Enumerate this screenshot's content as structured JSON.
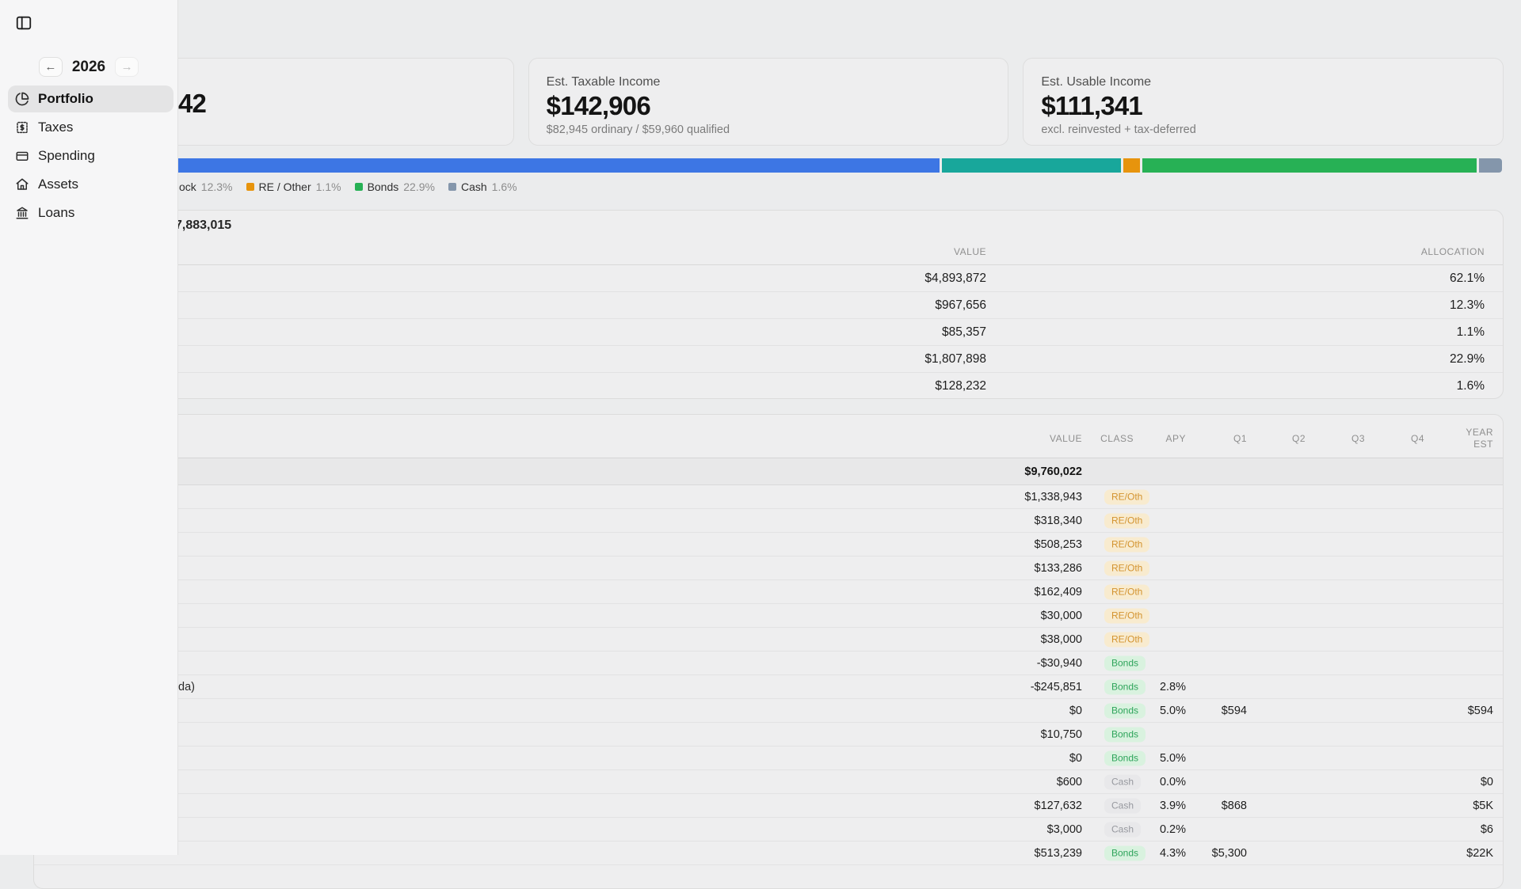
{
  "sidebar": {
    "year": "2026",
    "prev_label": "←",
    "next_label": "→",
    "items": [
      {
        "label": "Portfolio",
        "icon": "pie-chart-icon",
        "active": true
      },
      {
        "label": "Taxes",
        "icon": "receipt-icon",
        "active": false
      },
      {
        "label": "Spending",
        "icon": "credit-card-icon",
        "active": false
      },
      {
        "label": "Assets",
        "icon": "house-icon",
        "active": false
      },
      {
        "label": "Loans",
        "icon": "bank-icon",
        "active": false
      }
    ]
  },
  "summary_cards": {
    "card1": {
      "value_fragment": "42"
    },
    "card2": {
      "label": "Est. Taxable Income",
      "value": "$142,906",
      "sub": "$82,945 ordinary / $59,960 qualified"
    },
    "card3": {
      "label": "Est. Usable Income",
      "value": "$111,341",
      "sub": "excl. reinvested + tax-deferred"
    }
  },
  "allocation": {
    "segments": [
      {
        "pct": 62.1,
        "color": "#3d76e4"
      },
      {
        "pct": 12.3,
        "color": "#18a79b"
      },
      {
        "pct": 1.1,
        "color": "#e7940d"
      },
      {
        "pct": 22.9,
        "color": "#27b155"
      },
      {
        "pct": 1.6,
        "color": "#8496ab"
      }
    ],
    "legend": {
      "frag": {
        "label": "ock",
        "pct": "12.3%"
      },
      "items": [
        {
          "label": "RE / Other",
          "pct": "1.1%",
          "color": "#e7940d"
        },
        {
          "label": "Bonds",
          "pct": "22.9%",
          "color": "#27b155"
        },
        {
          "label": "Cash",
          "pct": "1.6%",
          "color": "#8496ab"
        }
      ]
    }
  },
  "allocation_table": {
    "title_fragment": "7,883,015",
    "headers": {
      "value": "VALUE",
      "allocation": "ALLOCATION"
    },
    "rows": [
      {
        "value": "$4,893,872",
        "allocation": "62.1%"
      },
      {
        "value": "$967,656",
        "allocation": "12.3%"
      },
      {
        "value": "$85,357",
        "allocation": "1.1%"
      },
      {
        "value": "$1,807,898",
        "allocation": "22.9%"
      },
      {
        "value": "$128,232",
        "allocation": "1.6%"
      }
    ]
  },
  "holdings_table": {
    "headers": {
      "value": "VALUE",
      "class": "CLASS",
      "apy": "APY",
      "q1": "Q1",
      "q2": "Q2",
      "q3": "Q3",
      "q4": "Q4",
      "year_est": "YEAR EST"
    },
    "total": {
      "value": "$9,760,022"
    },
    "rows": [
      {
        "value": "$1,338,943",
        "class": "RE/Oth"
      },
      {
        "value": "$318,340",
        "class": "RE/Oth"
      },
      {
        "value": "$508,253",
        "class": "RE/Oth"
      },
      {
        "value": "$133,286",
        "class": "RE/Oth"
      },
      {
        "value": "$162,409",
        "class": "RE/Oth"
      },
      {
        "value": "$30,000",
        "class": "RE/Oth"
      },
      {
        "value": "$38,000",
        "class": "RE/Oth"
      },
      {
        "value": "-$30,940",
        "class": "Bonds"
      },
      {
        "label_fragment": "da)",
        "value": "-$245,851",
        "class": "Bonds",
        "apy": "2.8%"
      },
      {
        "value": "$0",
        "class": "Bonds",
        "apy": "5.0%",
        "q1": "$594",
        "year_est": "$594"
      },
      {
        "value": "$10,750",
        "class": "Bonds"
      },
      {
        "value": "$0",
        "class": "Bonds",
        "apy": "5.0%"
      },
      {
        "value": "$600",
        "class": "Cash",
        "apy": "0.0%",
        "year_est": "$0"
      },
      {
        "value": "$127,632",
        "class": "Cash",
        "apy": "3.9%",
        "q1": "$868",
        "year_est": "$5K"
      },
      {
        "value": "$3,000",
        "class": "Cash",
        "apy": "0.2%",
        "year_est": "$6"
      },
      {
        "value": "$513,239",
        "class": "Bonds",
        "apy": "4.3%",
        "q1": "$5,300",
        "year_est": "$22K"
      }
    ]
  }
}
